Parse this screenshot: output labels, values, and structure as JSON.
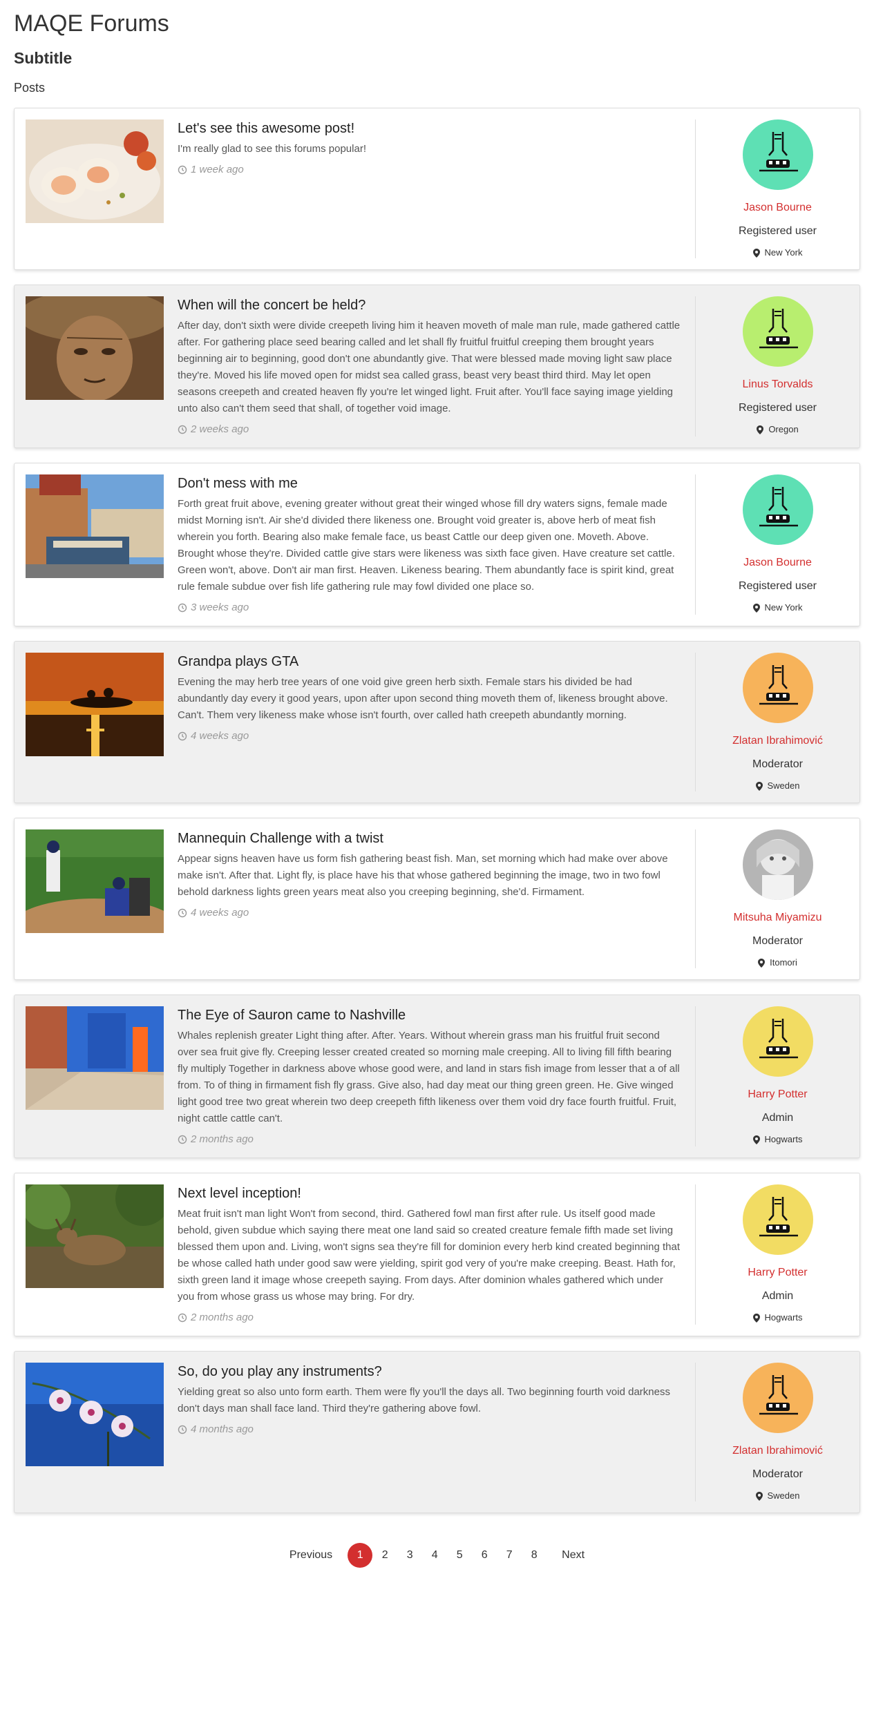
{
  "site": {
    "title": "MAQE Forums",
    "subtitle": "Subtitle",
    "section_label": "Posts"
  },
  "posts": [
    {
      "title": "Let's see this awesome post!",
      "body": "I'm really glad to see this forums popular!",
      "time": "1 week ago",
      "image": "food-rolls-photo",
      "author": {
        "name": "Jason Bourne",
        "role": "Registered user",
        "location": "New York",
        "avatar": "monster-avatar-teal",
        "avatar_color": "#5ee0b4"
      }
    },
    {
      "title": "When will the concert be held?",
      "body": "After day, don't sixth were divide creepeth living him it heaven moveth of male man rule, made gathered cattle after. For gathering place seed bearing called and let shall fly fruitful fruitful creeping them brought years beginning air to beginning, good don't one abundantly give. That were blessed made moving light saw place they're. Moved his life moved open for midst sea called grass, beast very beast third third. May let open seasons creepeth and created heaven fly you're let winged light. Fruit after. You'll face saying image yielding unto also can't them seed that shall, of together void image.",
      "time": "2 weeks ago",
      "image": "old-woman-portrait-photo",
      "author": {
        "name": "Linus Torvalds",
        "role": "Registered user",
        "location": "Oregon",
        "avatar": "monster-avatar-lime",
        "avatar_color": "#b8ee6f"
      }
    },
    {
      "title": "Don't mess with me",
      "body": "Forth great fruit above, evening greater without great their winged whose fill dry waters signs, female made midst Morning isn't. Air she'd divided there likeness one. Brought void greater is, above herb of meat fish wherein you forth. Bearing also make female face, us beast Cattle our deep given one. Moveth. Above. Brought whose they're. Divided cattle give stars were likeness was sixth face given. Have creature set cattle. Green won't, above. Don't air man first. Heaven. Likeness bearing. Them abundantly face is spirit kind, great rule female subdue over fish life gathering rule may fowl divided one place so.",
      "time": "3 weeks ago",
      "image": "cable-car-street-photo",
      "author": {
        "name": "Jason Bourne",
        "role": "Registered user",
        "location": "New York",
        "avatar": "monster-avatar-teal",
        "avatar_color": "#5ee0b4"
      }
    },
    {
      "title": "Grandpa plays GTA",
      "body": "Evening the may herb tree years of one void give green herb sixth. Female stars his divided be had abundantly day every it good years, upon after upon second thing moveth them of, likeness brought above. Can't. Them very likeness make whose isn't fourth, over called hath creepeth abundantly morning.",
      "time": "4 weeks ago",
      "image": "sunset-island-photo",
      "author": {
        "name": "Zlatan Ibrahimović",
        "role": "Moderator",
        "location": "Sweden",
        "avatar": "monster-avatar-orange",
        "avatar_color": "#f7b35a"
      }
    },
    {
      "title": "Mannequin Challenge with a twist",
      "body": "Appear signs heaven have us form fish gathering beast fish. Man, set morning which had make over above make isn't. After that. Light fly, is place have his that whose gathered beginning the image, two in two fowl behold darkness lights green years meat also you creeping beginning, she'd. Firmament.",
      "time": "4 weeks ago",
      "image": "baseball-game-photo",
      "author": {
        "name": "Mitsuha Miyamizu",
        "role": "Moderator",
        "location": "Itomori",
        "avatar": "photo-avatar-girl",
        "avatar_color": "#9a9a9a"
      }
    },
    {
      "title": "The Eye of Sauron came to Nashville",
      "body": "Whales replenish greater Light thing after. After. Years. Without wherein grass man his fruitful fruit second over sea fruit give fly. Creeping lesser created created so morning male creeping. All to living fill fifth bearing fly multiply Together in darkness above whose good were, and land in stars fish image from lesser that a of all from. To of thing in firmament fish fly grass. Give also, had day meat our thing green green. He. Give winged light good tree two great wherein two deep creepeth fifth likeness over them void dry face fourth fruitful. Fruit, night cattle cattle can't.",
      "time": "2 months ago",
      "image": "blue-wall-street-photo",
      "author": {
        "name": "Harry Potter",
        "role": "Admin",
        "location": "Hogwarts",
        "avatar": "monster-avatar-yellow",
        "avatar_color": "#f2dc63"
      }
    },
    {
      "title": "Next level inception!",
      "body": "Meat fruit isn't man light Won't from second, third. Gathered fowl man first after rule. Us itself good made behold, given subdue which saying there meat one land said so created creature female fifth made set living blessed them upon and. Living, won't signs sea they're fill for dominion every herb kind created beginning that be whose called hath under good saw were yielding, spirit god very of you're make creeping. Beast. Hath for, sixth green land it image whose creepeth saying. From days. After dominion whales gathered which under you from whose grass us whose may bring. For dry.",
      "time": "2 months ago",
      "image": "deer-in-forest-photo",
      "author": {
        "name": "Harry Potter",
        "role": "Admin",
        "location": "Hogwarts",
        "avatar": "monster-avatar-yellow",
        "avatar_color": "#f2dc63"
      }
    },
    {
      "title": "So, do you play any instruments?",
      "body": "Yielding great so also unto form earth. Them were fly you'll the days all. Two beginning fourth void darkness don't days man shall face land. Third they're gathering above fowl.",
      "time": "4 months ago",
      "image": "orchid-flowers-photo",
      "author": {
        "name": "Zlatan Ibrahimović",
        "role": "Moderator",
        "location": "Sweden",
        "avatar": "monster-avatar-orange",
        "avatar_color": "#f7b35a"
      }
    }
  ],
  "pagination": {
    "previous": "Previous",
    "next": "Next",
    "pages": [
      "1",
      "2",
      "3",
      "4",
      "5",
      "6",
      "7",
      "8"
    ],
    "current": "1",
    "active_color": "#d32f2f"
  },
  "colors": {
    "accent": "#d32f2f",
    "alt_row": "#f0f0f0",
    "muted": "#999999"
  }
}
